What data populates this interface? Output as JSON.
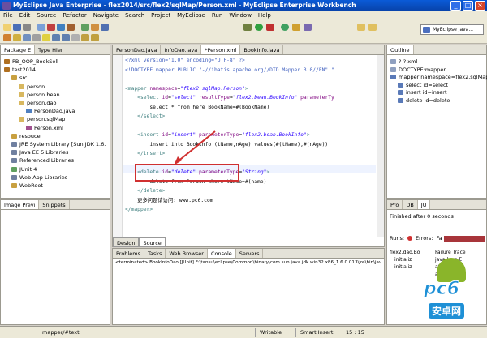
{
  "window": {
    "title": "MyEclipse Java Enterprise - flex2014/src/flex2/sqlMap/Person.xml - MyEclipse Enterprise Workbench",
    "min": "_",
    "max": "□",
    "close": "×"
  },
  "menu": [
    "File",
    "Edit",
    "Source",
    "Refactor",
    "Navigate",
    "Search",
    "Project",
    "MyEclipse",
    "Run",
    "Window",
    "Help"
  ],
  "perspective": "MyEclipse Java...",
  "left_panel": {
    "tabs": [
      "Package E",
      "Type Hier"
    ],
    "tree": [
      {
        "label": "PB_OOP_BookSell",
        "indent": 0
      },
      {
        "label": "test2014",
        "indent": 0
      },
      {
        "label": "src",
        "indent": 1
      },
      {
        "label": "person",
        "indent": 2
      },
      {
        "label": "person.bean",
        "indent": 2
      },
      {
        "label": "person.dao",
        "indent": 2
      },
      {
        "label": "PersonDao.java",
        "indent": 3
      },
      {
        "label": "person.sqlMap",
        "indent": 2
      },
      {
        "label": "Person.xml",
        "indent": 3
      },
      {
        "label": "resouce",
        "indent": 1
      },
      {
        "label": "JRE System Library [Sun JDK 1.6.",
        "indent": 1
      },
      {
        "label": "Java EE 5 Libraries",
        "indent": 1
      },
      {
        "label": "Referenced Libraries",
        "indent": 1
      },
      {
        "label": "JUnit 4",
        "indent": 1
      },
      {
        "label": "Web App Libraries",
        "indent": 1
      },
      {
        "label": "WebRoot",
        "indent": 1
      }
    ],
    "bottom_tabs": [
      "Image Previ",
      "Snippets"
    ]
  },
  "editor": {
    "tabs": [
      "PersonDao.java",
      "InfoDao.java",
      "*Person.xml",
      "BookInfo.java"
    ],
    "lines": [
      [
        [
          "pi",
          "<?xml version=\"1.0\" encoding=\"UTF-8\" ?>"
        ]
      ],
      [
        [
          "pi",
          "<!DOCTYPE mapper PUBLIC \"-//ibatis.apache.org//DTD Mapper 3.0//EN\" \""
        ]
      ],
      [],
      [
        [
          "tag",
          "<mapper "
        ],
        [
          "attr",
          "namespace"
        ],
        [
          "txt",
          "="
        ],
        [
          "val",
          "\"flex2.sqlMap.Person\""
        ],
        [
          "tag",
          ">"
        ]
      ],
      [
        [
          "tag",
          "    <select "
        ],
        [
          "attr",
          "id"
        ],
        [
          "txt",
          "="
        ],
        [
          "val",
          "\"select\" "
        ],
        [
          "attr",
          "resultType"
        ],
        [
          "txt",
          "="
        ],
        [
          "val",
          "\"flex2.bean.BookInfo\" "
        ],
        [
          "attr",
          "parameterTy"
        ]
      ],
      [
        [
          "txt",
          "        select * from here BookName=#(BookName)"
        ]
      ],
      [
        [
          "tag",
          "    </select>"
        ]
      ],
      [],
      [
        [
          "tag",
          "    <insert "
        ],
        [
          "attr",
          "id"
        ],
        [
          "txt",
          "="
        ],
        [
          "val",
          "\"insert\" "
        ],
        [
          "attr",
          "parameterType"
        ],
        [
          "txt",
          "="
        ],
        [
          "val",
          "\"flex2.bean.BookInfo\""
        ],
        [
          "tag",
          ">"
        ]
      ],
      [
        [
          "txt",
          "        insert into BookInfo (tName,nAge) values(#(tName),#(nAge))"
        ]
      ],
      [
        [
          "tag",
          "    </insert>"
        ]
      ],
      [],
      [
        [
          "tag",
          "    <delete "
        ],
        [
          "attr",
          "id"
        ],
        [
          "txt",
          "="
        ],
        [
          "val",
          "\"delete\" "
        ],
        [
          "attr",
          "parameterType"
        ],
        [
          "txt",
          "="
        ],
        [
          "val",
          "\"String\""
        ],
        [
          "tag",
          ">"
        ]
      ],
      [
        [
          "txt",
          "        delete from Person where tName=#(name)"
        ]
      ],
      [
        [
          "tag",
          "    </delete>"
        ]
      ],
      [
        [
          "txt",
          "    更多问题请访问: www.pc6.com"
        ]
      ],
      [
        [
          "tag",
          "</mapper>"
        ]
      ]
    ],
    "bottom_tabs": [
      "Design",
      "Source"
    ]
  },
  "outline": {
    "title": "Outline",
    "items": [
      {
        "label": "?-? xml",
        "indent": 0
      },
      {
        "label": "DOCTYPE:mapper",
        "indent": 0
      },
      {
        "label": "mapper namespace=flex2.sqlMap.P",
        "indent": 0
      },
      {
        "label": "select id=select",
        "indent": 1
      },
      {
        "label": "insert id=insert",
        "indent": 1
      },
      {
        "label": "delete id=delete",
        "indent": 1
      }
    ]
  },
  "junit": {
    "tabs": [
      "Pro",
      "DB",
      "JU"
    ],
    "finished": "Finished after 0 seconds",
    "runs_label": "Runs:",
    "errors_label": "Errors:",
    "failures_label": "Fa",
    "tree": [
      "flex2.dao.Bo",
      "initializ",
      "initializ"
    ],
    "failure_trace": "Failure Trace",
    "trace": [
      "java.lang.E",
      "at org.jun",
      "at org.jun"
    ]
  },
  "console": {
    "tabs": [
      "Problems",
      "Tasks",
      "Web Browser",
      "Console",
      "Servers"
    ],
    "line": "<terminated> BookInfoDao [JUnit] F:\\tansu\\eclipse\\Common\\binary\\com.sun.java.jdk.win32.x86_1.6.0.013\\jre\\bin\\javaw.exe ("
  },
  "status": {
    "left": "mapper/#text",
    "writable": "Writable",
    "insert": "Smart Insert",
    "pos": "15 : 15"
  },
  "watermark": {
    "text": "pc6",
    "sub": "安卓网"
  },
  "colors": {
    "title": "#0a5bd8",
    "junit_bar": "#a8353a",
    "highlight": "#d03030"
  }
}
